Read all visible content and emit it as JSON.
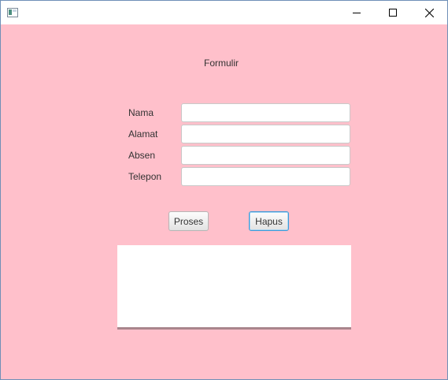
{
  "window": {
    "title": "",
    "controls": {
      "minimize_icon": "minimize-icon",
      "maximize_icon": "maximize-icon",
      "close_icon": "close-icon"
    },
    "background": "#ffc0cb"
  },
  "form": {
    "title": "Formulir",
    "fields": [
      {
        "label": "Nama",
        "value": ""
      },
      {
        "label": "Alamat",
        "value": ""
      },
      {
        "label": "Absen",
        "value": ""
      },
      {
        "label": "Telepon",
        "value": ""
      }
    ],
    "buttons": {
      "proses_label": "Proses",
      "hapus_label": "Hapus"
    },
    "output_text": ""
  }
}
